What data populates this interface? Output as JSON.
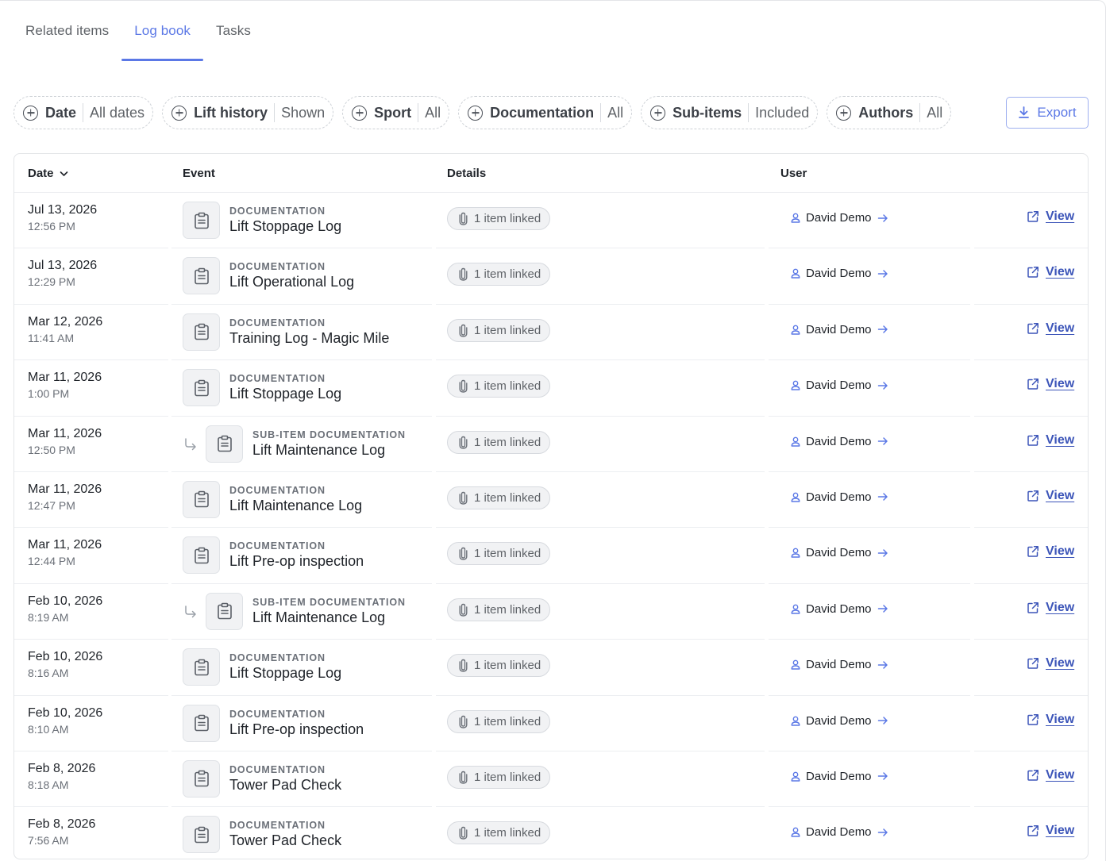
{
  "tabs": [
    {
      "label": "Related items",
      "active": false
    },
    {
      "label": "Log book",
      "active": true
    },
    {
      "label": "Tasks",
      "active": false
    }
  ],
  "filters": [
    {
      "label": "Date",
      "value": "All dates"
    },
    {
      "label": "Lift history",
      "value": "Shown"
    },
    {
      "label": "Sport",
      "value": "All"
    },
    {
      "label": "Documentation",
      "value": "All"
    },
    {
      "label": "Sub-items",
      "value": "Included"
    },
    {
      "label": "Authors",
      "value": "All"
    }
  ],
  "export_label": "Export",
  "columns": {
    "date": "Date",
    "event": "Event",
    "details": "Details",
    "user": "User"
  },
  "rows": [
    {
      "date": "Jul 13, 2026",
      "time": "12:56 PM",
      "type": "DOCUMENTATION",
      "name": "Lift Stoppage Log",
      "sub": false,
      "details": "1 item linked",
      "user": "David Demo",
      "action": "View"
    },
    {
      "date": "Jul 13, 2026",
      "time": "12:29 PM",
      "type": "DOCUMENTATION",
      "name": "Lift Operational Log",
      "sub": false,
      "details": "1 item linked",
      "user": "David Demo",
      "action": "View"
    },
    {
      "date": "Mar 12, 2026",
      "time": "11:41 AM",
      "type": "DOCUMENTATION",
      "name": "Training Log - Magic Mile",
      "sub": false,
      "details": "1 item linked",
      "user": "David Demo",
      "action": "View"
    },
    {
      "date": "Mar 11, 2026",
      "time": "1:00 PM",
      "type": "DOCUMENTATION",
      "name": "Lift Stoppage Log",
      "sub": false,
      "details": "1 item linked",
      "user": "David Demo",
      "action": "View"
    },
    {
      "date": "Mar 11, 2026",
      "time": "12:50 PM",
      "type": "SUB-ITEM DOCUMENTATION",
      "name": "Lift Maintenance Log",
      "sub": true,
      "details": "1 item linked",
      "user": "David Demo",
      "action": "View"
    },
    {
      "date": "Mar 11, 2026",
      "time": "12:47 PM",
      "type": "DOCUMENTATION",
      "name": "Lift Maintenance Log",
      "sub": false,
      "details": "1 item linked",
      "user": "David Demo",
      "action": "View"
    },
    {
      "date": "Mar 11, 2026",
      "time": "12:44 PM",
      "type": "DOCUMENTATION",
      "name": "Lift Pre-op inspection",
      "sub": false,
      "details": "1 item linked",
      "user": "David Demo",
      "action": "View"
    },
    {
      "date": "Feb 10, 2026",
      "time": "8:19 AM",
      "type": "SUB-ITEM DOCUMENTATION",
      "name": "Lift Maintenance Log",
      "sub": true,
      "details": "1 item linked",
      "user": "David Demo",
      "action": "View"
    },
    {
      "date": "Feb 10, 2026",
      "time": "8:16 AM",
      "type": "DOCUMENTATION",
      "name": "Lift Stoppage Log",
      "sub": false,
      "details": "1 item linked",
      "user": "David Demo",
      "action": "View"
    },
    {
      "date": "Feb 10, 2026",
      "time": "8:10 AM",
      "type": "DOCUMENTATION",
      "name": "Lift Pre-op inspection",
      "sub": false,
      "details": "1 item linked",
      "user": "David Demo",
      "action": "View"
    },
    {
      "date": "Feb 8, 2026",
      "time": "8:18 AM",
      "type": "DOCUMENTATION",
      "name": "Tower Pad Check",
      "sub": false,
      "details": "1 item linked",
      "user": "David Demo",
      "action": "View"
    },
    {
      "date": "Feb 8, 2026",
      "time": "7:56 AM",
      "type": "DOCUMENTATION",
      "name": "Tower Pad Check",
      "sub": false,
      "details": "1 item linked",
      "user": "David Demo",
      "action": "View"
    }
  ],
  "colors": {
    "accent": "#5b78e6",
    "link": "#3b54b8",
    "muted": "#6b7078",
    "border": "#e3e5e8"
  },
  "icons": {
    "filter": "plus-circle-icon",
    "export": "download-icon",
    "sort": "chevron-down-icon",
    "event": "clipboard-icon",
    "sub_item": "sub-item-arrow-icon",
    "details": "paperclip-icon",
    "user": "user-icon",
    "user_link": "arrow-right-icon",
    "view": "external-link-icon"
  }
}
